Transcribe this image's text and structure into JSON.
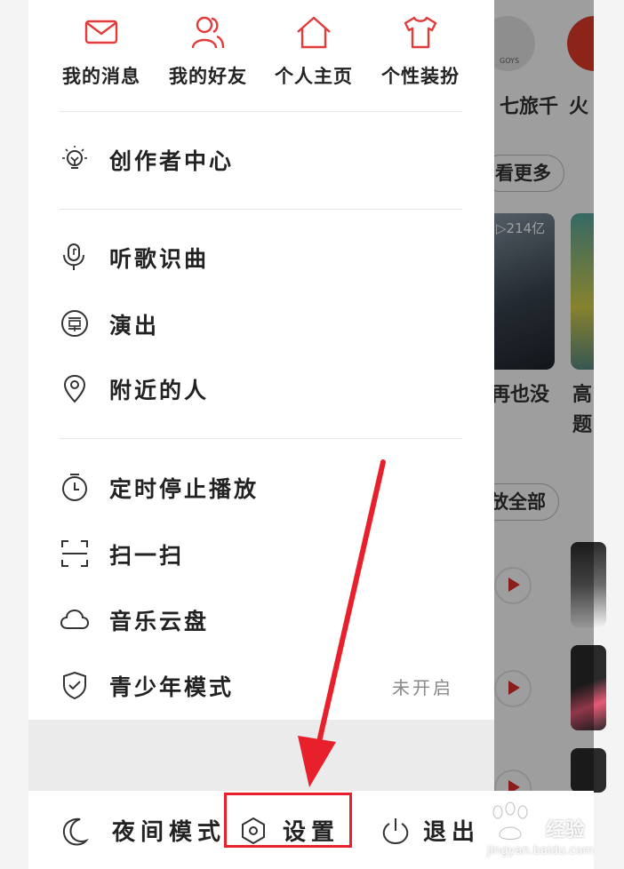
{
  "colors": {
    "accent": "#e8202c",
    "icon_red": "#e33a3a",
    "text": "#222222",
    "muted": "#888888"
  },
  "quick_actions": [
    {
      "label": "我的消息",
      "icon": "mail-icon"
    },
    {
      "label": "我的好友",
      "icon": "friends-icon"
    },
    {
      "label": "个人主页",
      "icon": "home-icon"
    },
    {
      "label": "个性装扮",
      "icon": "tshirt-icon"
    }
  ],
  "creator": {
    "label": "创作者中心",
    "icon": "lightbulb-icon"
  },
  "menu_group_1": [
    {
      "label": "听歌识曲",
      "icon": "music-recognition-icon"
    },
    {
      "label": "演出",
      "icon": "ticket-icon"
    },
    {
      "label": "附近的人",
      "icon": "location-pin-icon"
    }
  ],
  "menu_group_2": [
    {
      "label": "定时停止播放",
      "icon": "timer-icon"
    },
    {
      "label": "扫一扫",
      "icon": "scan-icon"
    },
    {
      "label": "音乐云盘",
      "icon": "cloud-icon"
    },
    {
      "label": "青少年模式",
      "icon": "shield-check-icon",
      "status": "未开启"
    }
  ],
  "bottom_bar": {
    "night_mode": "夜间模式",
    "settings": "设置",
    "logout": "退出"
  },
  "background_app": {
    "avatar_text": "GOYS",
    "row1_labels": [
      "七旅千",
      "火"
    ],
    "see_more": "看更多",
    "card_badge": "▷214亿",
    "card_titles": [
      "再也没",
      "高",
      "题"
    ],
    "play_all": "放全部"
  },
  "watermark": {
    "brand": "经验",
    "url": "jingyan.baidu.com"
  }
}
